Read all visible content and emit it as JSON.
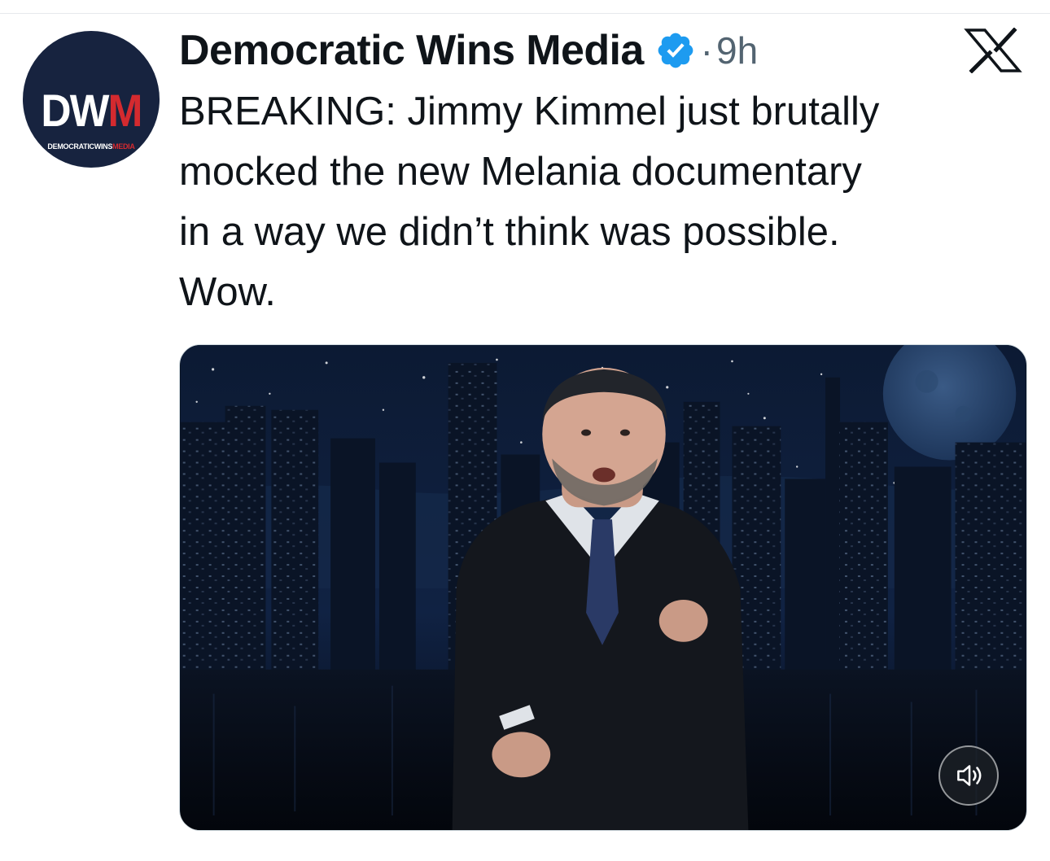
{
  "author": {
    "display_name": "Democratic Wins Media",
    "verified": true,
    "avatar_mark_white": "DW",
    "avatar_mark_red": "M",
    "avatar_sub_white": "DEMOCRATICWINS",
    "avatar_sub_red": "MEDIA"
  },
  "meta": {
    "separator": "·",
    "time_ago": "9h"
  },
  "platform_icon": "x-logo-icon",
  "tweet": {
    "text": "BREAKING: Jimmy Kimmel just brutally\nmocked the new Melania documentary\nin a way we didn’t think was possible.\nWow."
  },
  "media": {
    "type": "video",
    "icons": [
      "speaker-muted-icon"
    ]
  },
  "colors": {
    "text_primary": "#0f1419",
    "text_secondary": "#536471",
    "verified_blue": "#1d9bf0",
    "avatar_bg": "#17233f",
    "avatar_red": "#d42a2f"
  }
}
